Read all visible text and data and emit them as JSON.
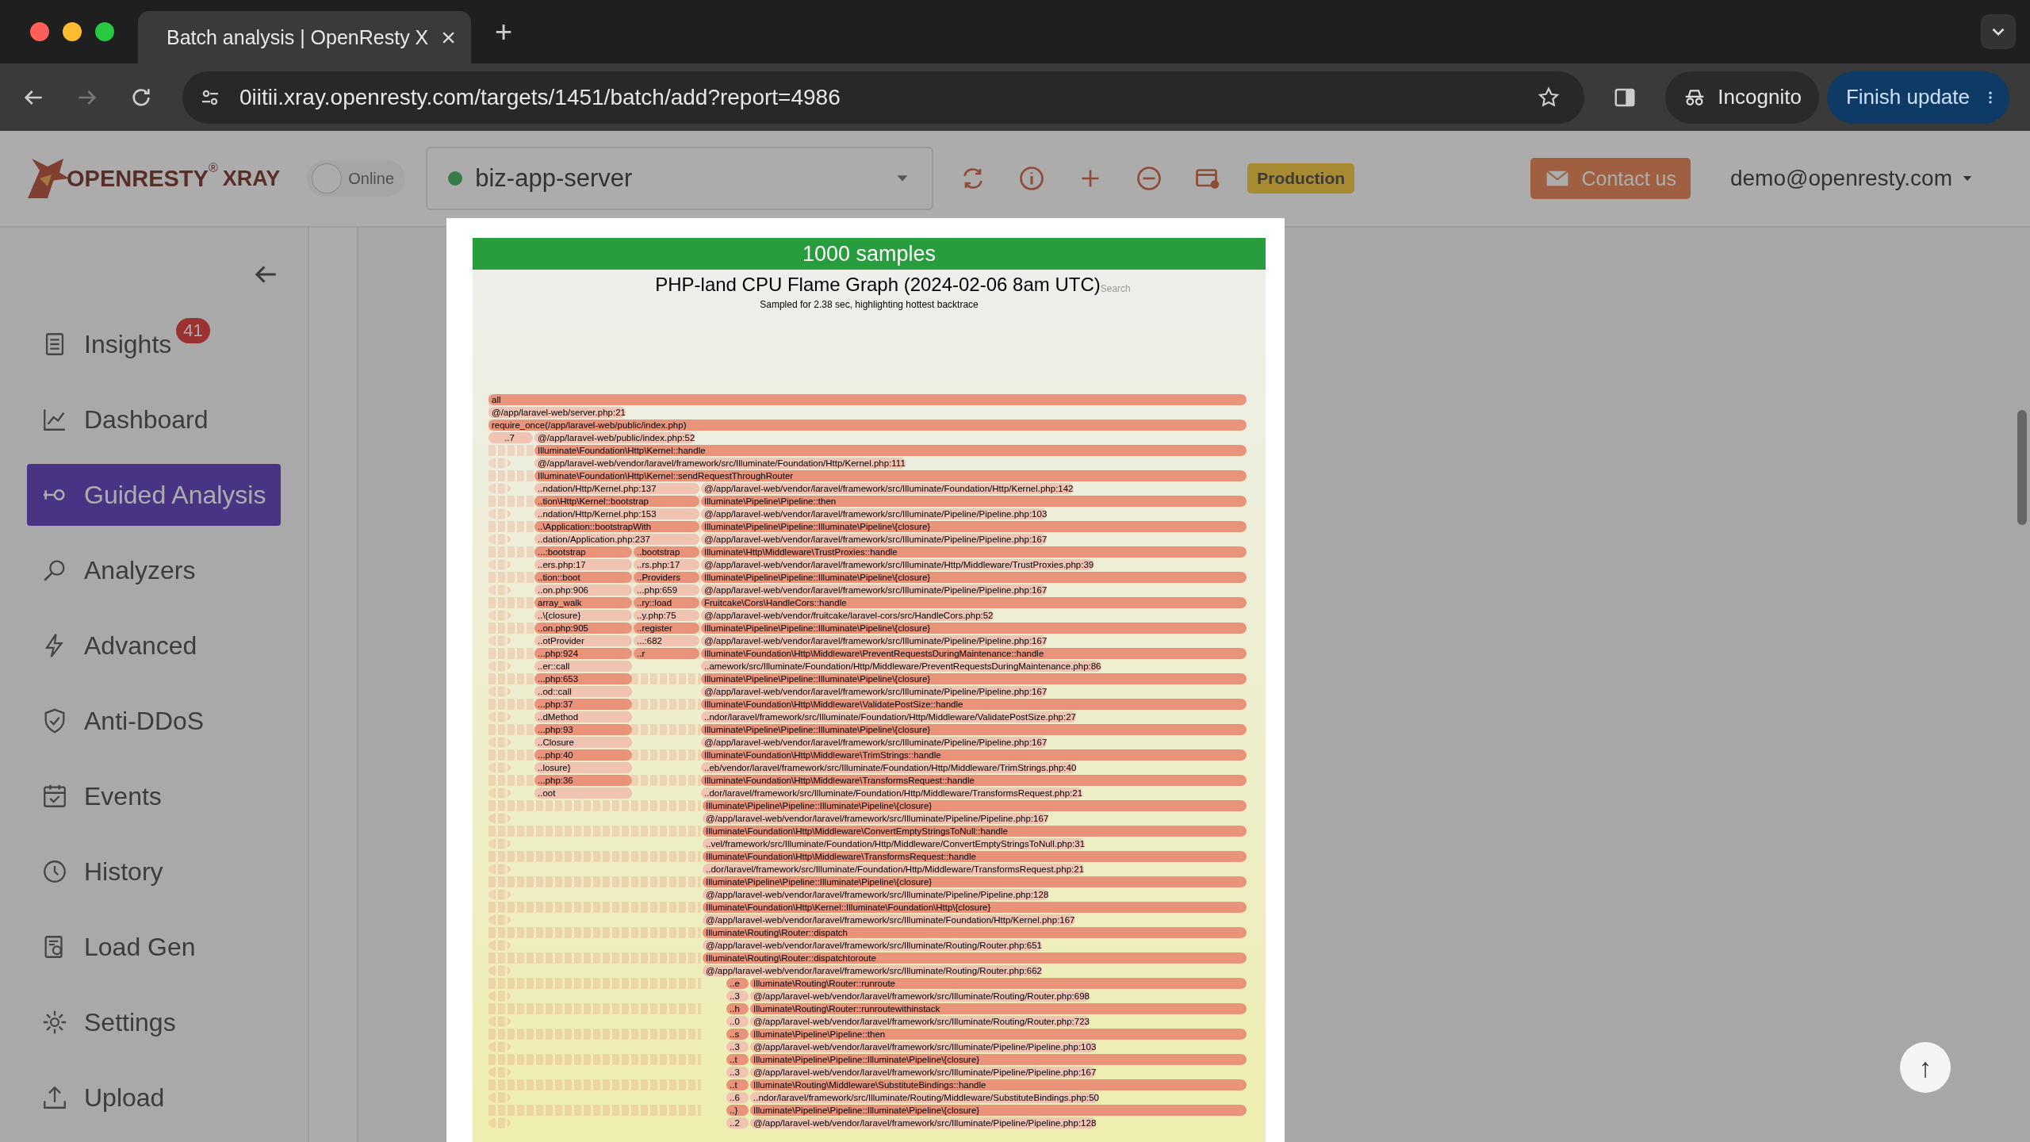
{
  "browser": {
    "tab": {
      "title": "Batch analysis | OpenResty X",
      "close": "×"
    },
    "new_tab": "+",
    "url": "0iitii.xray.openresty.com/targets/1451/batch/add?report=4986",
    "incognito": "Incognito",
    "finish_update": "Finish update"
  },
  "header": {
    "logo": {
      "brand": "OPENRESTY",
      "mark": "®",
      "product": "XRAY"
    },
    "online_toggle": {
      "label": "Online",
      "on": false
    },
    "target": {
      "name": "biz-app-server",
      "online": true
    },
    "environment": "Production",
    "contact": "Contact us",
    "account": "demo@openresty.com"
  },
  "sidebar": {
    "items": [
      {
        "label": "Insights",
        "badge": "41",
        "selected": false
      },
      {
        "label": "Dashboard",
        "selected": false
      },
      {
        "label": "Guided Analysis",
        "selected": true
      },
      {
        "label": "Analyzers",
        "selected": false
      },
      {
        "label": "Advanced",
        "selected": false
      },
      {
        "label": "Anti-DDoS",
        "selected": false
      },
      {
        "label": "Events",
        "selected": false
      },
      {
        "label": "History",
        "selected": false
      },
      {
        "label": "Load Gen",
        "selected": false
      },
      {
        "label": "Settings",
        "selected": false
      },
      {
        "label": "Upload",
        "selected": false
      }
    ]
  },
  "flame_graph": {
    "samples": "1000 samples",
    "title": "PHP-land CPU Flame Graph (2024-02-06 8am UTC)",
    "search": "Search",
    "subtitle": "Sampled for 2.38 sec, highlighting hottest backtrace",
    "rows": [
      [
        {
          "kind": "full",
          "label": "all"
        }
      ],
      [
        {
          "kind": "full",
          "label": "@/app/laravel-web/server.php:21"
        }
      ],
      [
        {
          "kind": "full",
          "label": "require_once(/app/laravel-web/public/index.php)"
        }
      ],
      [
        {
          "kind": "stub",
          "label": "..7"
        },
        {
          "kind": "rest",
          "label": "@/app/laravel-web/public/index.php:52"
        }
      ],
      [
        {
          "kind": "rest",
          "label": "Illuminate\\Foundation\\Http\\Kernel::handle"
        }
      ],
      [
        {
          "kind": "rest",
          "label": "@/app/laravel-web/vendor/laravel/framework/src/Illuminate/Foundation/Http/Kernel.php:111"
        }
      ],
      [
        {
          "kind": "rest",
          "label": "Illuminate\\Foundation\\Http\\Kernel::sendRequestThroughRouter"
        }
      ],
      [
        {
          "kind": "wide",
          "label": "..ndation/Http/Kernel.php:137"
        },
        {
          "kind": "main",
          "label": "@/app/laravel-web/vendor/laravel/framework/src/Illuminate/Foundation/Http/Kernel.php:142"
        }
      ],
      [
        {
          "kind": "wide",
          "label": "..tion\\Http\\Kernel::bootstrap"
        },
        {
          "kind": "main",
          "label": "Illuminate\\Pipeline\\Pipeline::then"
        }
      ],
      [
        {
          "kind": "wide",
          "label": "..ndation/Http/Kernel.php:153"
        },
        {
          "kind": "main",
          "label": "@/app/laravel-web/vendor/laravel/framework/src/Illuminate/Pipeline/Pipeline.php:103"
        }
      ],
      [
        {
          "kind": "wide",
          "label": "..\\Application::bootstrapWith"
        },
        {
          "kind": "main",
          "label": "Illuminate\\Pipeline\\Pipeline::Illuminate\\Pipeline\\{closure}"
        }
      ],
      [
        {
          "kind": "wide",
          "label": "..dation/Application.php:237"
        },
        {
          "kind": "main",
          "label": "@/app/laravel-web/vendor/laravel/framework/src/Illuminate/Pipeline/Pipeline.php:167"
        }
      ],
      [
        {
          "kind": "left",
          "label": "...:bootstrap"
        },
        {
          "kind": "mid",
          "label": "..bootstrap"
        },
        {
          "kind": "main",
          "label": "Illuminate\\Http\\Middleware\\TrustProxies::handle"
        }
      ],
      [
        {
          "kind": "left",
          "label": "..ers.php:17"
        },
        {
          "kind": "mid",
          "label": "..rs.php:17"
        },
        {
          "kind": "main",
          "label": "@/app/laravel-web/vendor/laravel/framework/src/Illuminate/Http/Middleware/TrustProxies.php:39"
        }
      ],
      [
        {
          "kind": "left",
          "label": "..tion::boot"
        },
        {
          "kind": "mid",
          "label": "..Providers"
        },
        {
          "kind": "main",
          "label": "Illuminate\\Pipeline\\Pipeline::Illuminate\\Pipeline\\{closure}"
        }
      ],
      [
        {
          "kind": "left",
          "label": "..on.php:906"
        },
        {
          "kind": "mid",
          "label": "...php:659"
        },
        {
          "kind": "main",
          "label": "@/app/laravel-web/vendor/laravel/framework/src/Illuminate/Pipeline/Pipeline.php:167"
        }
      ],
      [
        {
          "kind": "left",
          "label": "array_walk"
        },
        {
          "kind": "mid",
          "label": "..ry::load"
        },
        {
          "kind": "main",
          "label": "Fruitcake\\Cors\\HandleCors::handle"
        }
      ],
      [
        {
          "kind": "left",
          "label": "..\\{closure}"
        },
        {
          "kind": "mid",
          "label": "..y.php:75"
        },
        {
          "kind": "main",
          "label": "@/app/laravel-web/vendor/fruitcake/laravel-cors/src/HandleCors.php:52"
        }
      ],
      [
        {
          "kind": "left",
          "label": "..on.php:905"
        },
        {
          "kind": "mid",
          "label": "..register"
        },
        {
          "kind": "main",
          "label": "Illuminate\\Pipeline\\Pipeline::Illuminate\\Pipeline\\{closure}"
        }
      ],
      [
        {
          "kind": "left",
          "label": "..otProvider"
        },
        {
          "kind": "mid",
          "label": "...:682"
        },
        {
          "kind": "main",
          "label": "@/app/laravel-web/vendor/laravel/framework/src/Illuminate/Pipeline/Pipeline.php:167"
        }
      ],
      [
        {
          "kind": "left",
          "label": "...php:924"
        },
        {
          "kind": "mid",
          "label": "..r"
        },
        {
          "kind": "main",
          "label": "Illuminate\\Foundation\\Http\\Middleware\\PreventRequestsDuringMaintenance::handle"
        }
      ],
      [
        {
          "kind": "left",
          "label": "..er::call"
        },
        {
          "kind": "main",
          "label": "..amework/src/Illuminate/Foundation/Http/Middleware/PreventRequestsDuringMaintenance.php:86"
        }
      ],
      [
        {
          "kind": "left",
          "label": "...php:653"
        },
        {
          "kind": "main",
          "label": "Illuminate\\Pipeline\\Pipeline::Illuminate\\Pipeline\\{closure}"
        }
      ],
      [
        {
          "kind": "left",
          "label": "..od::call"
        },
        {
          "kind": "main",
          "label": "@/app/laravel-web/vendor/laravel/framework/src/Illuminate/Pipeline/Pipeline.php:167"
        }
      ],
      [
        {
          "kind": "left",
          "label": "...php:37"
        },
        {
          "kind": "main",
          "label": "Illuminate\\Foundation\\Http\\Middleware\\ValidatePostSize::handle"
        }
      ],
      [
        {
          "kind": "left",
          "label": "..dMethod"
        },
        {
          "kind": "main",
          "label": "..ndor/laravel/framework/src/Illuminate/Foundation/Http/Middleware/ValidatePostSize.php:27"
        }
      ],
      [
        {
          "kind": "left",
          "label": "...php:93"
        },
        {
          "kind": "main",
          "label": "Illuminate\\Pipeline\\Pipeline::Illuminate\\Pipeline\\{closure}"
        }
      ],
      [
        {
          "kind": "left",
          "label": "..Closure"
        },
        {
          "kind": "main",
          "label": "@/app/laravel-web/vendor/laravel/framework/src/Illuminate/Pipeline/Pipeline.php:167"
        }
      ],
      [
        {
          "kind": "left",
          "label": "...php:40"
        },
        {
          "kind": "main",
          "label": "Illuminate\\Foundation\\Http\\Middleware\\TrimStrings::handle"
        }
      ],
      [
        {
          "kind": "left",
          "label": "..losure}"
        },
        {
          "kind": "main",
          "label": "..eb/vendor/laravel/framework/src/Illuminate/Foundation/Http/Middleware/TrimStrings.php:40"
        }
      ],
      [
        {
          "kind": "left",
          "label": "...php:36"
        },
        {
          "kind": "main",
          "label": "Illuminate\\Foundation\\Http\\Middleware\\TransformsRequest::handle"
        }
      ],
      [
        {
          "kind": "left",
          "label": "..oot"
        },
        {
          "kind": "main",
          "label": "..dor/laravel/framework/src/Illuminate/Foundation/Http/Middleware/TransformsRequest.php:21"
        }
      ],
      [
        {
          "kind": "main",
          "label": "Illuminate\\Pipeline\\Pipeline::Illuminate\\Pipeline\\{closure}"
        }
      ],
      [
        {
          "kind": "main",
          "label": "@/app/laravel-web/vendor/laravel/framework/src/Illuminate/Pipeline/Pipeline.php:167"
        }
      ],
      [
        {
          "kind": "main",
          "label": "Illuminate\\Foundation\\Http\\Middleware\\ConvertEmptyStringsToNull::handle"
        }
      ],
      [
        {
          "kind": "main",
          "label": "..vel/framework/src/Illuminate/Foundation/Http/Middleware/ConvertEmptyStringsToNull.php:31"
        }
      ],
      [
        {
          "kind": "main",
          "label": "Illuminate\\Foundation\\Http\\Middleware\\TransformsRequest::handle"
        }
      ],
      [
        {
          "kind": "main",
          "label": "..dor/laravel/framework/src/Illuminate/Foundation/Http/Middleware/TransformsRequest.php:21"
        }
      ],
      [
        {
          "kind": "main",
          "label": "Illuminate\\Pipeline\\Pipeline::Illuminate\\Pipeline\\{closure}"
        }
      ],
      [
        {
          "kind": "main",
          "label": "@/app/laravel-web/vendor/laravel/framework/src/Illuminate/Pipeline/Pipeline.php:128"
        }
      ],
      [
        {
          "kind": "main",
          "label": "Illuminate\\Foundation\\Http\\Kernel::Illuminate\\Foundation\\Http\\{closure}"
        }
      ],
      [
        {
          "kind": "main",
          "label": "@/app/laravel-web/vendor/laravel/framework/src/Illuminate/Foundation/Http/Kernel.php:167"
        }
      ],
      [
        {
          "kind": "main",
          "label": "Illuminate\\Routing\\Router::dispatch"
        }
      ],
      [
        {
          "kind": "main",
          "label": "@/app/laravel-web/vendor/laravel/framework/src/Illuminate/Routing/Router.php:651"
        }
      ],
      [
        {
          "kind": "main",
          "label": "Illuminate\\Routing\\Router::dispatchtoroute"
        }
      ],
      [
        {
          "kind": "main",
          "label": "@/app/laravel-web/vendor/laravel/framework/src/Illuminate/Routing/Router.php:662"
        }
      ],
      [
        {
          "kind": "deepstub",
          "label": "..e"
        },
        {
          "kind": "deep",
          "label": "Illuminate\\Routing\\Router::runroute"
        }
      ],
      [
        {
          "kind": "deepstub",
          "label": "..3"
        },
        {
          "kind": "deep",
          "label": "@/app/laravel-web/vendor/laravel/framework/src/Illuminate/Routing/Router.php:698"
        }
      ],
      [
        {
          "kind": "deepstub",
          "label": "..h"
        },
        {
          "kind": "deep",
          "label": "Illuminate\\Routing\\Router::runroutewithinstack"
        }
      ],
      [
        {
          "kind": "deepstub",
          "label": "..0"
        },
        {
          "kind": "deep",
          "label": "@/app/laravel-web/vendor/laravel/framework/src/Illuminate/Routing/Router.php:723"
        }
      ],
      [
        {
          "kind": "deepstub",
          "label": "..s"
        },
        {
          "kind": "deep",
          "label": "Illuminate\\Pipeline\\Pipeline::then"
        }
      ],
      [
        {
          "kind": "deepstub",
          "label": "..3"
        },
        {
          "kind": "deep",
          "label": "@/app/laravel-web/vendor/laravel/framework/src/Illuminate/Pipeline/Pipeline.php:103"
        }
      ],
      [
        {
          "kind": "deepstub",
          "label": "..t"
        },
        {
          "kind": "deep",
          "label": "Illuminate\\Pipeline\\Pipeline::Illuminate\\Pipeline\\{closure}"
        }
      ],
      [
        {
          "kind": "deepstub",
          "label": "..3"
        },
        {
          "kind": "deep",
          "label": "@/app/laravel-web/vendor/laravel/framework/src/Illuminate/Pipeline/Pipeline.php:167"
        }
      ],
      [
        {
          "kind": "deepstub",
          "label": "..t"
        },
        {
          "kind": "deep",
          "label": "Illuminate\\Routing\\Middleware\\SubstituteBindings::handle"
        }
      ],
      [
        {
          "kind": "deepstub",
          "label": "..6"
        },
        {
          "kind": "deep",
          "label": "..ndor/laravel/framework/src/Illuminate/Routing/Middleware/SubstituteBindings.php:50"
        }
      ],
      [
        {
          "kind": "deepstub",
          "label": "..}"
        },
        {
          "kind": "deep",
          "label": "Illuminate\\Pipeline\\Pipeline::Illuminate\\Pipeline\\{closure}"
        }
      ],
      [
        {
          "kind": "deepstub",
          "label": "..2"
        },
        {
          "kind": "deep",
          "label": "@/app/laravel-web/vendor/laravel/framework/src/Illuminate/Pipeline/Pipeline.php:128"
        }
      ]
    ]
  },
  "scroll_top": "↑"
}
